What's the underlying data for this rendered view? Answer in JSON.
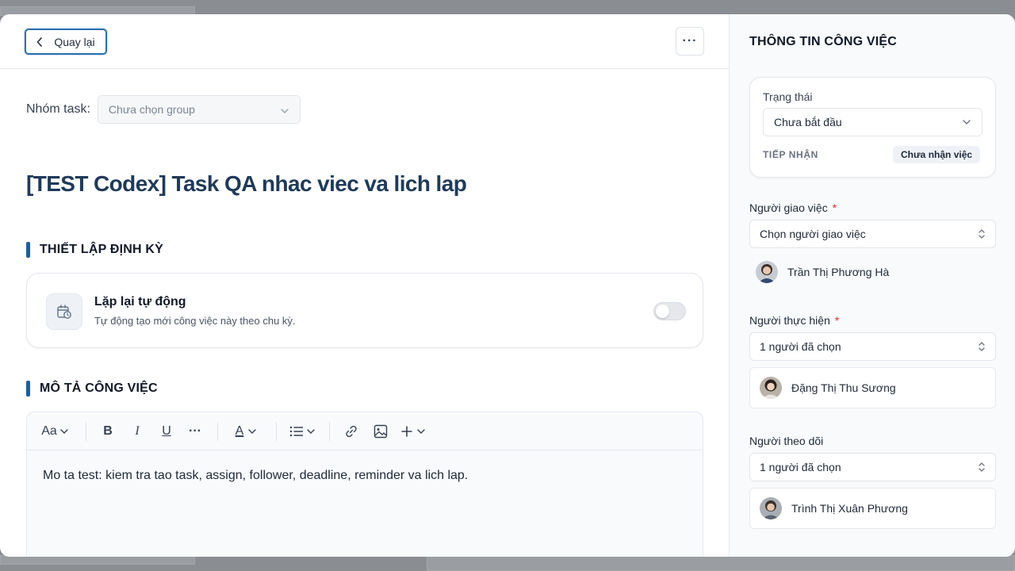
{
  "header": {
    "back_label": "Quay lại",
    "more_label": "···"
  },
  "group": {
    "label": "Nhóm task:",
    "placeholder": "Chưa chọn group"
  },
  "task": {
    "title": "[TEST Codex] Task QA nhac viec va lich lap"
  },
  "recurrence": {
    "section_title": "THIẾT LẬP ĐỊNH KỲ",
    "title": "Lặp lại tự động",
    "subtitle": "Tự động tạo mới công việc này theo chu kỳ.",
    "enabled": false
  },
  "description": {
    "section_title": "MÔ TẢ CÔNG VIỆC",
    "toolbar": {
      "font_label": "Aa",
      "bold": "B",
      "italic": "I",
      "underline": "U",
      "more": "···",
      "color_letter": "A"
    },
    "content": "Mo ta test: kiem tra tao task, assign, follower, deadline, reminder va lich lap."
  },
  "sidebar": {
    "title": "THÔNG TIN CÔNG VIỆC",
    "status": {
      "label": "Trạng thái",
      "value": "Chưa bắt đầu",
      "receive_label": "TIẾP NHẬN",
      "receive_value": "Chưa nhận việc"
    },
    "assigner": {
      "label": "Người giao việc",
      "required_mark": "*",
      "placeholder": "Chọn người giao việc",
      "person": "Trần Thị Phương Hà"
    },
    "assignee": {
      "label": "Người thực hiện",
      "required_mark": "*",
      "value": "1 người đã chọn",
      "person": "Đặng Thị Thu Sương"
    },
    "follower": {
      "label": "Người theo dõi",
      "value": "1 người đã chọn",
      "person": "Trình Thị Xuân Phương"
    }
  },
  "colors": {
    "accent": "#1a5f9e",
    "title": "#1f3a5a",
    "required": "#dc2626"
  }
}
